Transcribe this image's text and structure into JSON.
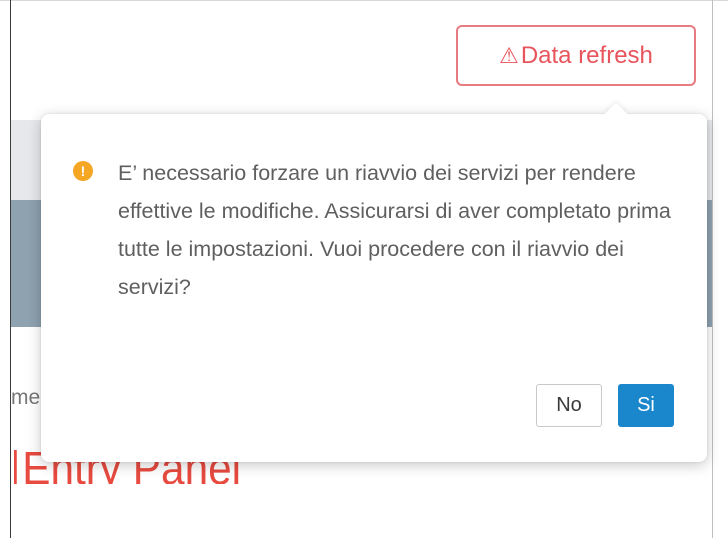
{
  "header": {
    "refresh_button": {
      "icon": "warning-triangle-icon",
      "label": "Data refresh",
      "color": "#e8545c"
    }
  },
  "background": {
    "field_label": "me",
    "panel_title": "Entry Panel"
  },
  "popover": {
    "icon": "exclamation-circle-icon",
    "icon_color": "#f5a623",
    "message": "E’ necessario forzare un riavvio dei servizi per rendere effettive le modifiche. Assicurarsi di aver completato prima tutte le impostazioni. Vuoi procedere con il riavvio dei servizi?",
    "no_label": "No",
    "yes_label": "Si",
    "yes_color": "#1a86cc"
  }
}
